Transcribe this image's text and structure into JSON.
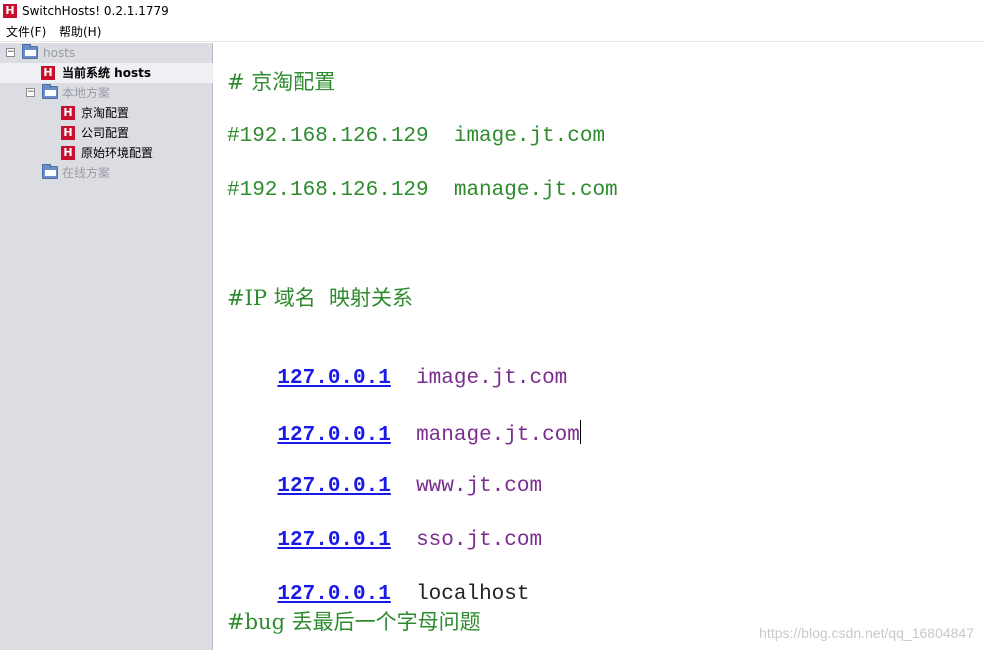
{
  "window": {
    "app_icon_letter": "H",
    "title": "SwitchHosts! 0.2.1.1779"
  },
  "menu": {
    "items": [
      {
        "label": "文件(F)"
      },
      {
        "label": "帮助(H)"
      }
    ]
  },
  "sidebar": {
    "root": {
      "label": "hosts",
      "expander": "−"
    },
    "current": {
      "label": "当前系统 hosts",
      "icon_letter": "H"
    },
    "local": {
      "label": "本地方案",
      "expander": "−",
      "items": [
        {
          "label": "京淘配置",
          "icon_letter": "H"
        },
        {
          "label": "公司配置",
          "icon_letter": "H"
        },
        {
          "label": "原始环境配置",
          "icon_letter": "H"
        }
      ]
    },
    "online": {
      "label": "在线方案"
    }
  },
  "editor": {
    "comment_title": "# 京淘配置",
    "comment_line1": "#192.168.126.129  image.jt.com",
    "comment_line2": "#192.168.126.129  manage.jt.com",
    "mapping_comment": "#IP 域名  映射关系",
    "entries": [
      {
        "ip": "127.0.0.1",
        "host": "image.jt.com"
      },
      {
        "ip": "127.0.0.1",
        "host": "manage.jt.com"
      },
      {
        "ip": "127.0.0.1",
        "host": "www.jt.com"
      },
      {
        "ip": "127.0.0.1",
        "host": "sso.jt.com"
      },
      {
        "ip": "127.0.0.1",
        "host": "localhost"
      }
    ],
    "bug_comment": "#bug 丢最后一个字母问题"
  },
  "watermark": "https://blog.csdn.net/qq_16804847",
  "colors": {
    "comment": "#2e8b2e",
    "ip": "#1a1ae6",
    "host": "#7b2c8f",
    "icon_red": "#c8102e",
    "sidebar_bg": "#dcdde3"
  }
}
